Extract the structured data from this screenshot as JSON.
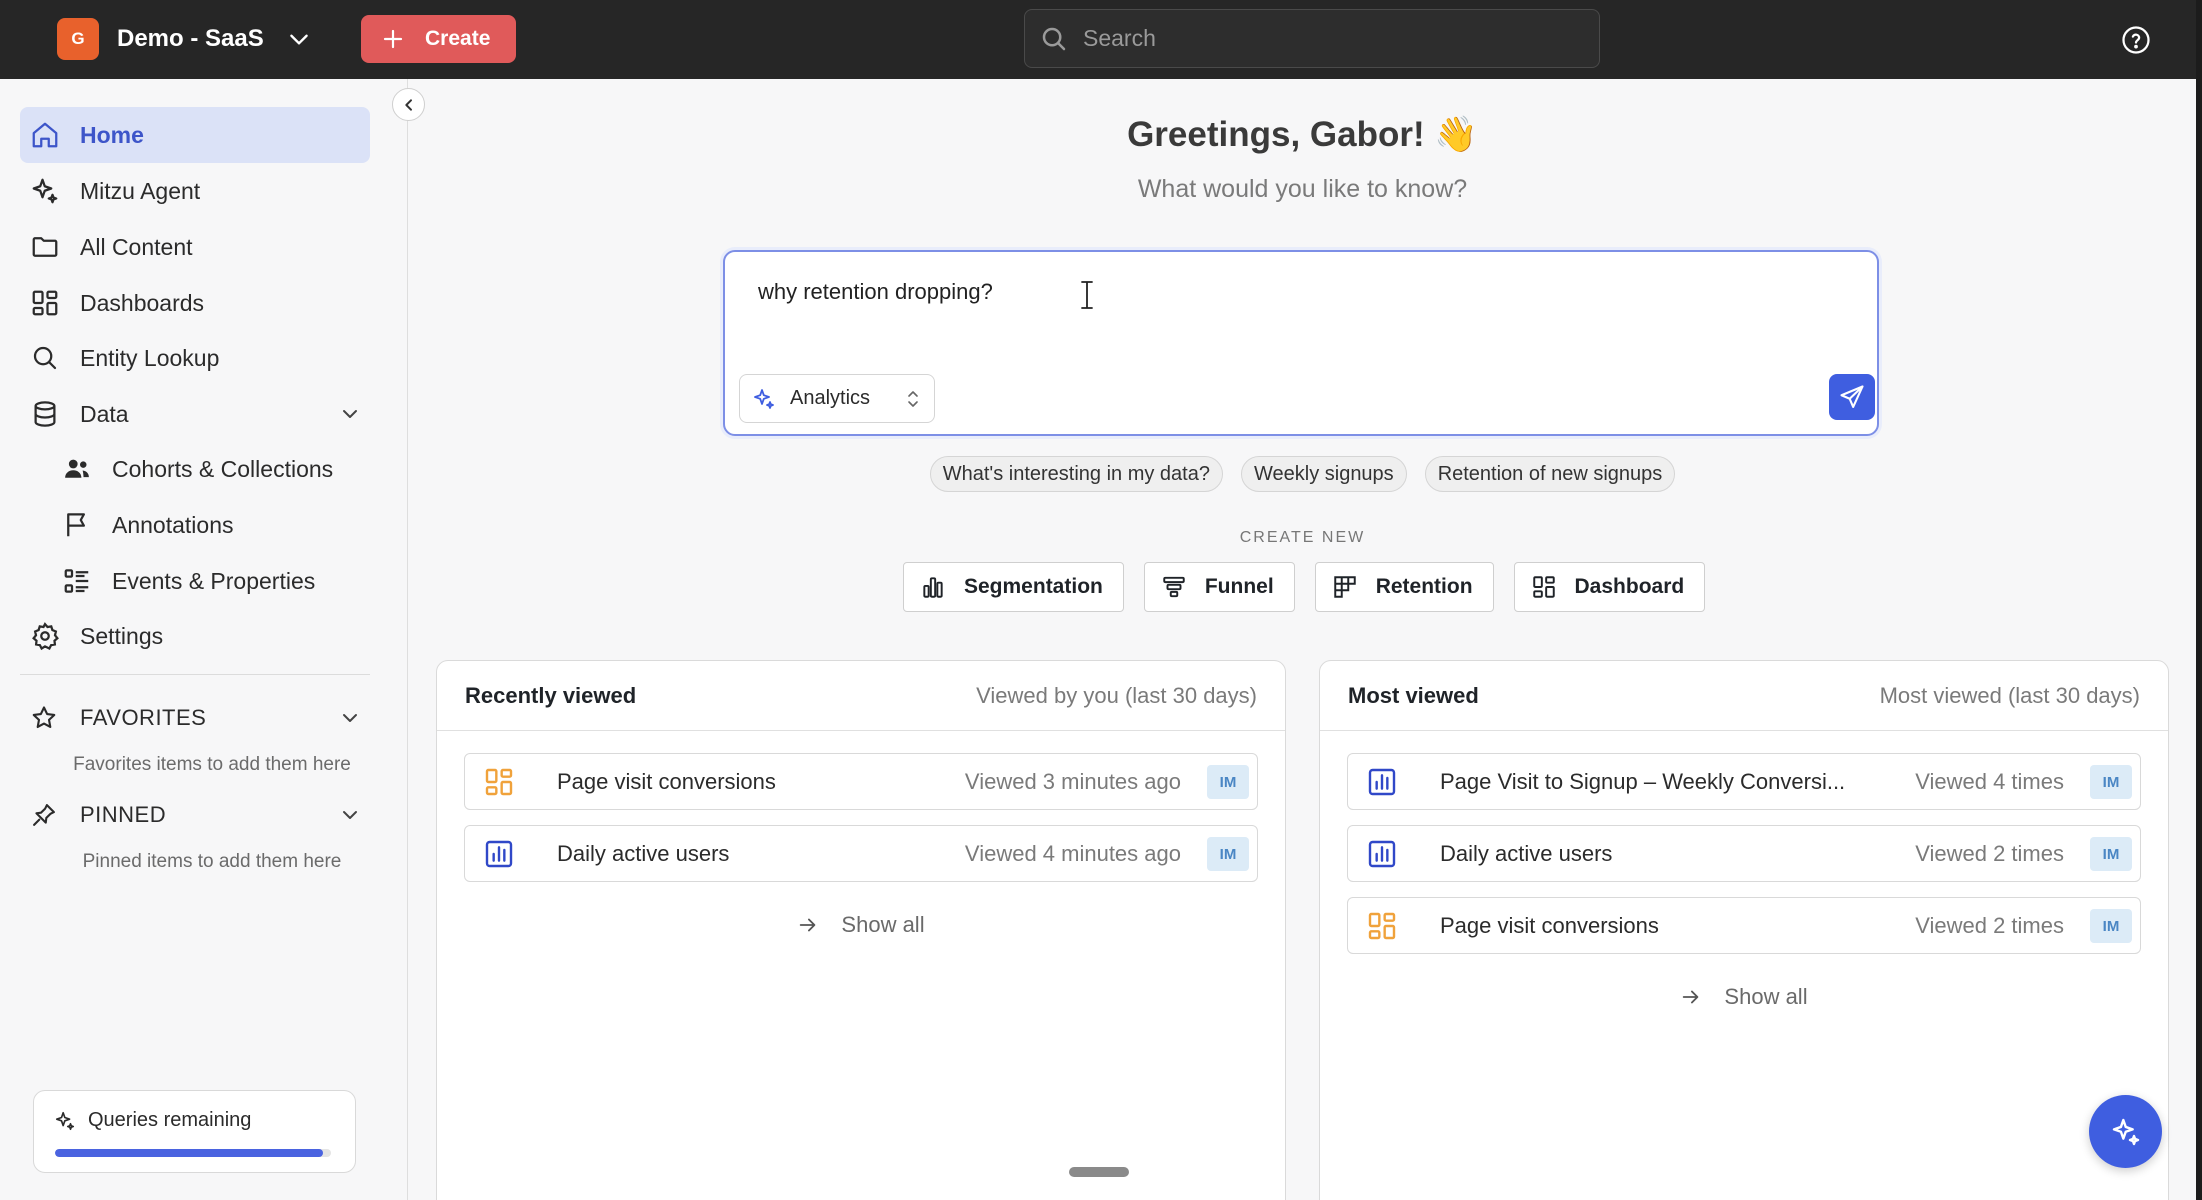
{
  "topbar": {
    "org_initial": "G",
    "org_name": "Demo - SaaS",
    "create_label": "Create",
    "search_placeholder": "Search"
  },
  "sidebar": {
    "items": [
      {
        "label": "Home"
      },
      {
        "label": "Mitzu Agent"
      },
      {
        "label": "All Content"
      },
      {
        "label": "Dashboards"
      },
      {
        "label": "Entity Lookup"
      },
      {
        "label": "Data"
      }
    ],
    "data_sub": [
      {
        "label": "Cohorts & Collections"
      },
      {
        "label": "Annotations"
      },
      {
        "label": "Events & Properties"
      }
    ],
    "settings_label": "Settings",
    "favorites": {
      "label": "FAVORITES",
      "hint": "Favorites items to add them here"
    },
    "pinned": {
      "label": "PINNED",
      "hint": "Pinned items to add them here"
    },
    "queries": {
      "label": "Queries remaining",
      "progress": 0.97
    }
  },
  "main": {
    "greeting": "Greetings, Gabor! 👋",
    "subtitle": "What would you like to know?",
    "prompt_value": "why retention dropping?",
    "mode_label": "Analytics",
    "suggestions": [
      "What's interesting in my data?",
      "Weekly signups",
      "Retention of new signups"
    ],
    "create_new_label": "CREATE NEW",
    "create_buttons": [
      {
        "label": "Segmentation",
        "icon": "bar-chart-icon"
      },
      {
        "label": "Funnel",
        "icon": "funnel-icon"
      },
      {
        "label": "Retention",
        "icon": "retention-grid-icon"
      },
      {
        "label": "Dashboard",
        "icon": "dashboard-icon"
      }
    ]
  },
  "recent": {
    "title": "Recently viewed",
    "subtitle": "Viewed by you (last 30 days)",
    "items": [
      {
        "name": "Page visit conversions",
        "meta": "Viewed 3 minutes ago",
        "avatar": "IM",
        "icon": "dashboard-icon"
      },
      {
        "name": "Daily active users",
        "meta": "Viewed 4 minutes ago",
        "avatar": "IM",
        "icon": "insight-chart-icon"
      }
    ],
    "show_all": "Show all"
  },
  "most": {
    "title": "Most viewed",
    "subtitle": "Most viewed (last 30 days)",
    "items": [
      {
        "name": "Page Visit to Signup – Weekly Conversi...",
        "meta": "Viewed 4 times",
        "avatar": "IM",
        "icon": "insight-chart-icon"
      },
      {
        "name": "Daily active users",
        "meta": "Viewed 2 times",
        "avatar": "IM",
        "icon": "insight-chart-icon"
      },
      {
        "name": "Page visit conversions",
        "meta": "Viewed 2 times",
        "avatar": "IM",
        "icon": "dashboard-icon"
      }
    ],
    "show_all": "Show all"
  },
  "colors": {
    "accent": "#3f5ee0",
    "create": "#e05a5a",
    "org_badge": "#e8612c",
    "dashboard_icon": "#f0a23b"
  }
}
